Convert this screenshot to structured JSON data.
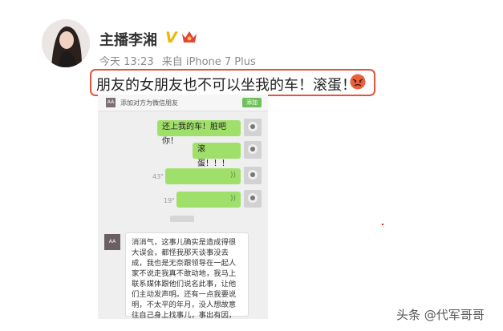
{
  "post": {
    "username": "主播李湘",
    "verified_badge": "V",
    "meta_time": "今天 13:23",
    "meta_source": "来自 iPhone 7 Plus",
    "text": "朋友的女朋友也不可以坐我的车！滚蛋！",
    "highlight_color": "#e2553b"
  },
  "chat": {
    "header_text": "添加对方为微信朋友",
    "header_button": "添加",
    "header_icon_text": "AA",
    "messages": [
      {
        "side": "right",
        "type": "text",
        "text": "还上我的车！脏吧你！"
      },
      {
        "side": "right",
        "type": "text",
        "text": "滚蛋！！！"
      },
      {
        "side": "right",
        "type": "voice",
        "duration": "43\"",
        "icon": "voice-wave-icon"
      },
      {
        "side": "right",
        "type": "voice",
        "duration": "19\"",
        "icon": "voice-wave-icon"
      }
    ],
    "left_message": {
      "avatar_text": "AA",
      "text": "消消气，这事儿确实是造成得很大误会，都怪我那天谈事没去成，我也是无奈跟领导在一起人家不说走我真不敢动地，我马上联系媒体跟他们说名此事，让他们主动发声明。还有一点我要说明，不太平的年月，没人想故意往自己身上找事儿，事出有因，还请多谅解。"
    },
    "bubble_color": "#9fe06a"
  },
  "watermark": "头条 @代军哥哥"
}
